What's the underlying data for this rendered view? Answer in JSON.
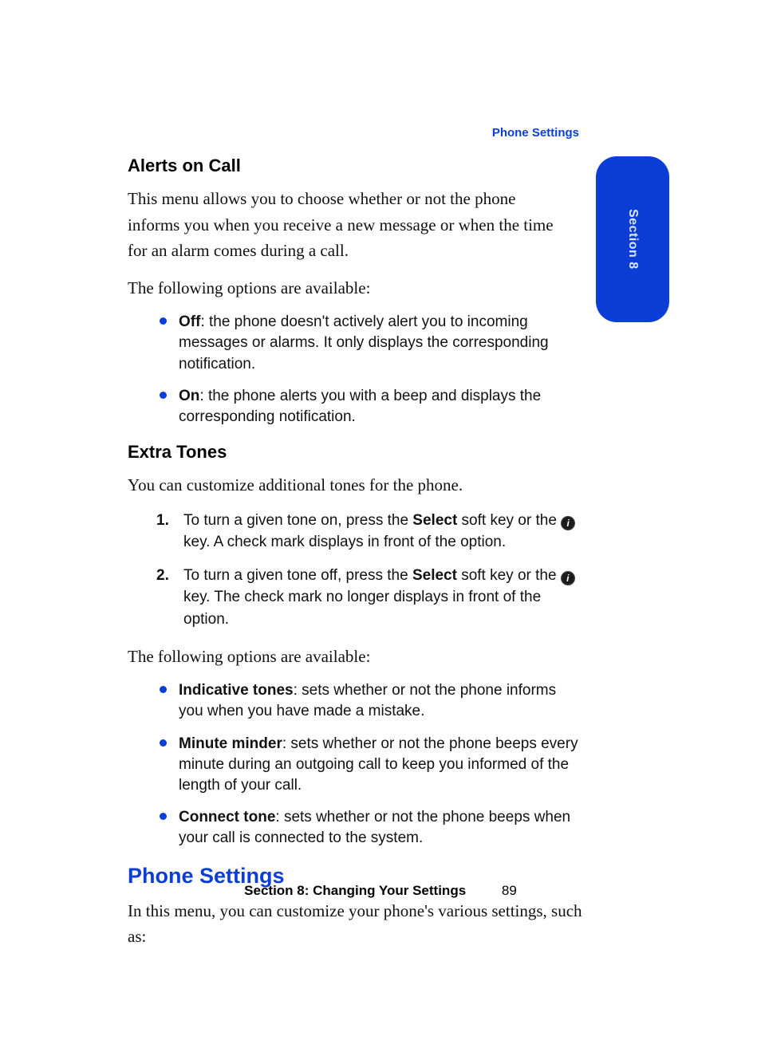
{
  "header": {
    "running_title": "Phone Settings"
  },
  "side_tab": {
    "label": "Section 8"
  },
  "content": {
    "h_alerts": "Alerts on Call",
    "p_alerts_intro": "This menu allows you to choose whether or not the phone informs you when you receive a new message or when the time for an alarm comes during a call.",
    "p_options_available_1": "The following options are available:",
    "bullets_alerts": {
      "b0_term": "Off",
      "b0_rest": ": the phone doesn't actively alert you to incoming messages or alarms. It only displays the corresponding notification.",
      "b1_term": "On",
      "b1_rest": ": the phone alerts you with a beep and displays the corresponding notification."
    },
    "h_extra": "Extra Tones",
    "p_extra_intro": "You can customize additional tones for the phone.",
    "steps": {
      "s1_a": "To turn a given tone on, press the ",
      "s1_b": "Select",
      "s1_c": " soft key or the ",
      "s1_d": " key. A check mark displays in front of the option.",
      "s2_a": "To turn a given tone off, press the ",
      "s2_b": "Select",
      "s2_c": " soft key or the ",
      "s2_d": " key. The check mark no longer displays in front of the option."
    },
    "p_options_available_2": "The following options are available:",
    "bullets_extra": {
      "b0_term": "Indicative tones",
      "b0_rest": ": sets whether or not the phone informs you when you have made a mistake.",
      "b1_term": "Minute minder",
      "b1_rest": ": sets whether or not the phone beeps every minute during an outgoing call to keep you informed of the length of your call.",
      "b2_term": "Connect tone",
      "b2_rest": ": sets whether or not the phone beeps when your call is connected to the system."
    },
    "h_phone_settings": "Phone Settings",
    "p_phone_settings_intro": "In this menu, you can customize your phone's various settings, such as:"
  },
  "key_icon_glyph": "i",
  "footer": {
    "text": "Section 8: Changing Your Settings",
    "page_number": "89"
  }
}
